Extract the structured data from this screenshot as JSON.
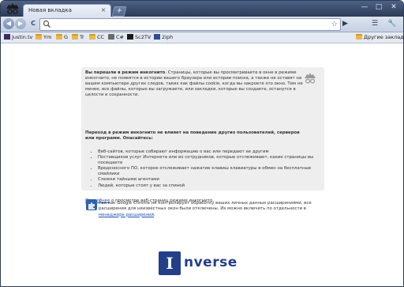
{
  "tabs": [
    {
      "label": "Новая вкладка",
      "close": "×"
    }
  ],
  "new_tab": "+",
  "window": {
    "minimize": "—",
    "maximize": "□",
    "close": "✕"
  },
  "toolbar": {
    "back": "◀",
    "forward": "▶",
    "reload": "C",
    "omnibox_value": "",
    "omnibox_placeholder": "",
    "go": "▶",
    "page_menu": "☰",
    "tools_menu": "🔧"
  },
  "bookmarks": [
    {
      "label": "Justin.tv",
      "icon": "justin-tv-icon"
    },
    {
      "label": "Ym",
      "icon": "folder-icon"
    },
    {
      "label": "G",
      "icon": "folder-icon"
    },
    {
      "label": "Tr",
      "icon": "folder-icon"
    },
    {
      "label": "CC",
      "icon": "folder-icon"
    },
    {
      "label": "C#",
      "icon": "csharp-icon"
    },
    {
      "label": "Sc2TV",
      "icon": "sc2tv-icon"
    },
    {
      "label": "2iph",
      "icon": "2iph-icon"
    }
  ],
  "other_bookmarks": "Другие закладки",
  "incognito": {
    "intro_title": "Вы перешли в режим инкогнито",
    "intro_body": ". Страницы, которые вы просматриваете в окне в режиме инкогнито, не появятся в истории вашего браузера или истории поиска, а также не оставят на вашем компьютере других следов, таких как файлы cookie, когда вы закроете это окно. Тем не менее, все файлы, которые вы загружаете, или закладки, которые вы создаете, останутся в целости и сохранности.",
    "warning": "Переход в режим инкогнито не влияет на поведение других пользователей, серверов или программ. Опасайтесь:",
    "list": [
      "Веб-сайтов, которые собирают информацию о вас или передают ее другим",
      "Поставщиков услуг Интернета или их сотрудников, которые отслеживают, какие страницы вы посещаете",
      "Вредоносного ПО, которое отслеживает нажатие клавиш клавиатуры в обмен на бесплатные смайлики",
      "Слежки тайными агентами",
      "Людей, которые стоят у вас за спиной"
    ],
    "learn_more_link": "Подробнее",
    "learn_more_rest": " о просмотре веб-страниц режиме инкогнито."
  },
  "extensions": {
    "text": "Так как Google Chrome не контролирует обработку ваших личных данных расширениями, все расширения для неизвестных окон были отключены. Их можно включить по отдельности в ",
    "link": "менеджере расширений",
    "tail": "."
  },
  "watermark": {
    "letter": "I",
    "word": "nverse"
  },
  "colors": {
    "accent": "#243f8a",
    "link": "#2050b8",
    "titlebar": "#3a4c6e"
  }
}
